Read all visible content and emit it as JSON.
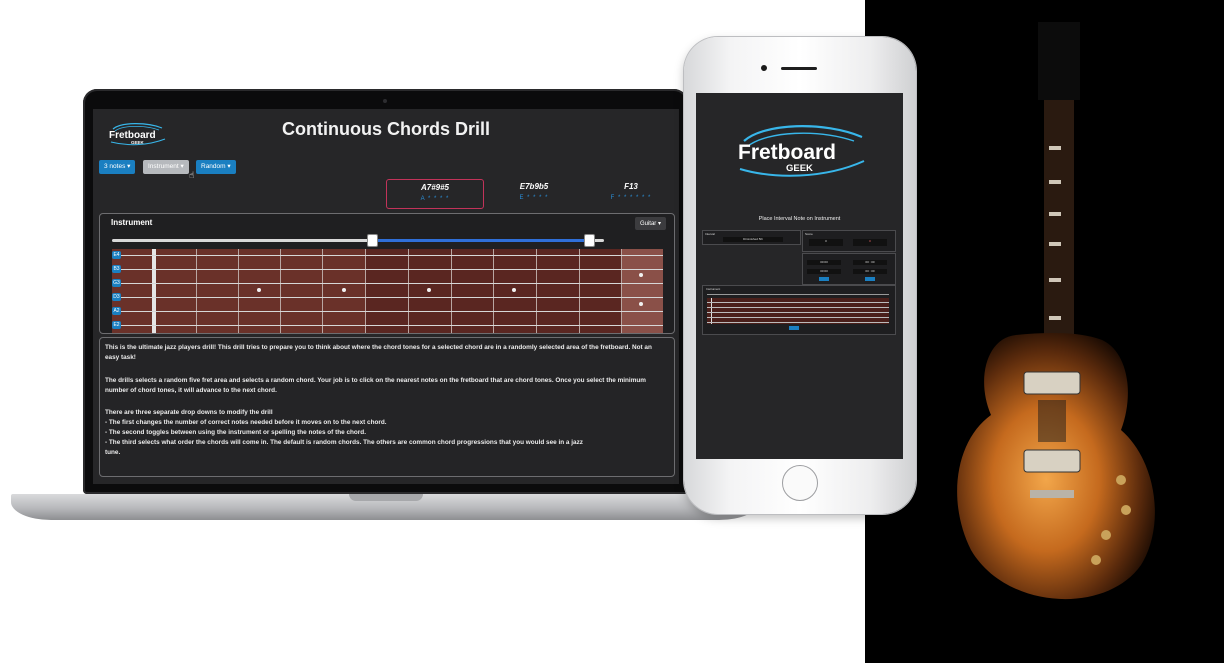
{
  "laptop_app": {
    "title": "Continuous Chords Drill",
    "logo": {
      "word": "Fretboard",
      "sub": "GEEK"
    },
    "buttons": {
      "notes": "3 notes",
      "mode": "Instrument",
      "order": "Random"
    },
    "chords": [
      {
        "name": "A7#9#5",
        "notes": "A * * * *",
        "active": true
      },
      {
        "name": "E7b9b5",
        "notes": "E * * * *",
        "active": false
      },
      {
        "name": "F13",
        "notes": "F * * * * * *",
        "active": false
      }
    ],
    "instrument": {
      "title": "Instrument",
      "selector": "Guitar",
      "strings": [
        "E4",
        "B3",
        "G3",
        "D3",
        "A2",
        "E2"
      ]
    },
    "description": {
      "p1": "This is the ultimate jazz players drill! This drill tries to prepare you to think about where the chord tones for a selected chord are in a randomly selected area of the fretboard. Not an easy task!",
      "p2": "The drills selects a random five fret area and selects a random chord. Your job is to click on the nearest notes on the fretboard that are chord tones. Once you select the minimum number of chord tones, it will advance to the next chord.",
      "p3_head": "There are three separate drop downs to modify the drill",
      "p3_l1": "- The first changes the number of correct notes needed before it moves on to the next chord.",
      "p3_l2": "- The second toggles between using the instrument or spelling the notes of the chord.",
      "p3_l3": "- The third selects what order the chords will come in. The default is random chords. The others are common chord progressions that you would see in a jazz",
      "p3_l4": "tune."
    }
  },
  "phone_app": {
    "logo": {
      "word": "Fretboard",
      "sub": "GEEK"
    },
    "title": "Place Interval Note on Instrument",
    "interval_label": "Interval",
    "interval_value": "Diminished 5th",
    "score_label": "Score",
    "score_a": "0",
    "score_b": "0",
    "time_a": "00:00",
    "time_b": "00 : 00",
    "instrument_label": "Instrument"
  },
  "colors": {
    "accent_blue": "#1a7fc1",
    "active_chord_border": "#c2335a",
    "fretboard": "#6a3129",
    "screen_bg": "#262628"
  }
}
